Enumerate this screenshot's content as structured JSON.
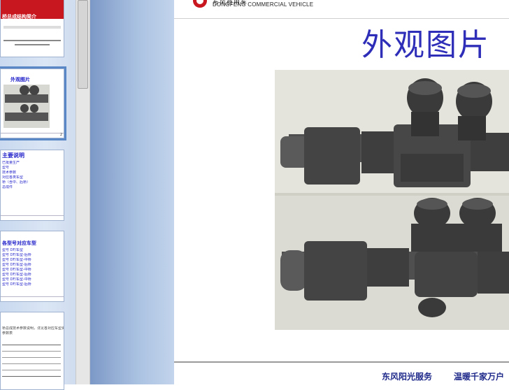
{
  "thumbnails": [
    {
      "index": 1,
      "title": "桥总成结构简介",
      "lines": []
    },
    {
      "index": 2,
      "title": "外观图片",
      "lines": []
    },
    {
      "index": 3,
      "title": "主要说明",
      "lines": [
        "已批量生产",
        "型号",
        "技术参数",
        "对应各类车型",
        "桥（含中、后桥）",
        "总成件"
      ]
    },
    {
      "index": 4,
      "title": "各型号对应车型",
      "lines": [
        "型号 DF/车型",
        "型号 DF/车型-后桥",
        "型号 DF/车型-中桥",
        "型号 DF/车型-后桥",
        "型号 DF/车型-中桥",
        "型号 DF/车型-后桥",
        "型号 DF/车型-中桥",
        "型号 DF/车型-后桥"
      ]
    },
    {
      "index": 5,
      "title": "",
      "lines": [
        "桥总成技术参数说明，详见各对应车型资料",
        "参数表"
      ]
    }
  ],
  "slide": {
    "brand_cn": "东风商用车",
    "brand_en": "DONGFENG COMMERCIAL VEHICLE",
    "title": "外观图片",
    "footer_left": "东风阳光服务",
    "footer_right": "温暖千家万户"
  },
  "colors": {
    "title_blue": "#2e2eb8",
    "footer_blue": "#1f2a8a",
    "logo_red": "#c8171f",
    "selection_outline": "#5a87c6"
  }
}
